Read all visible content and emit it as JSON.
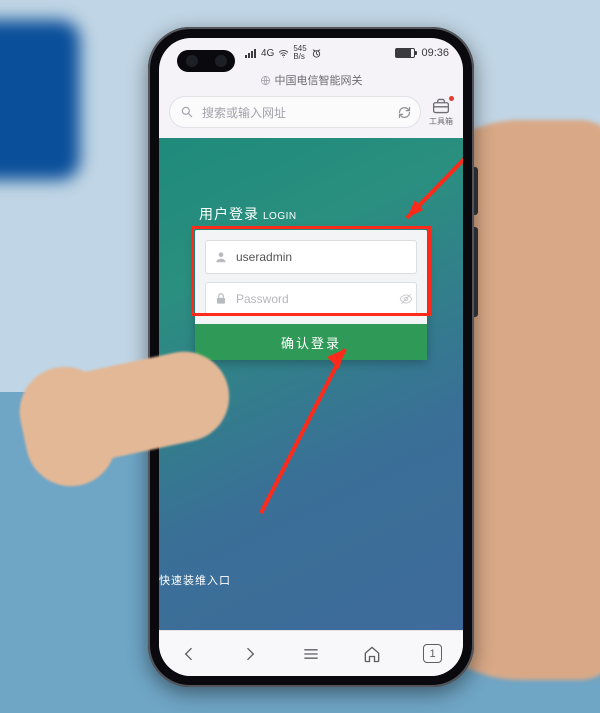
{
  "status": {
    "network_badge": "4G",
    "signal_kb": "545",
    "signal_unit": "B/s",
    "battery_icon": "battery-icon",
    "time": "09:36"
  },
  "browser": {
    "page_title": "中国电信智能网关",
    "search_placeholder": "搜索或输入网址",
    "refresh": "refresh-icon",
    "toolbox_label": "工具箱"
  },
  "login": {
    "heading_cn": "用户登录",
    "heading_en": "LOGIN",
    "username_value": "useradmin",
    "password_placeholder": "Password",
    "submit_label": "确认登录",
    "quick_link": "快速装维入口"
  },
  "bottomnav": {
    "back": "back-icon",
    "forward": "forward-icon",
    "menu": "menu-icon",
    "home": "home-icon",
    "tab_count": "1"
  }
}
